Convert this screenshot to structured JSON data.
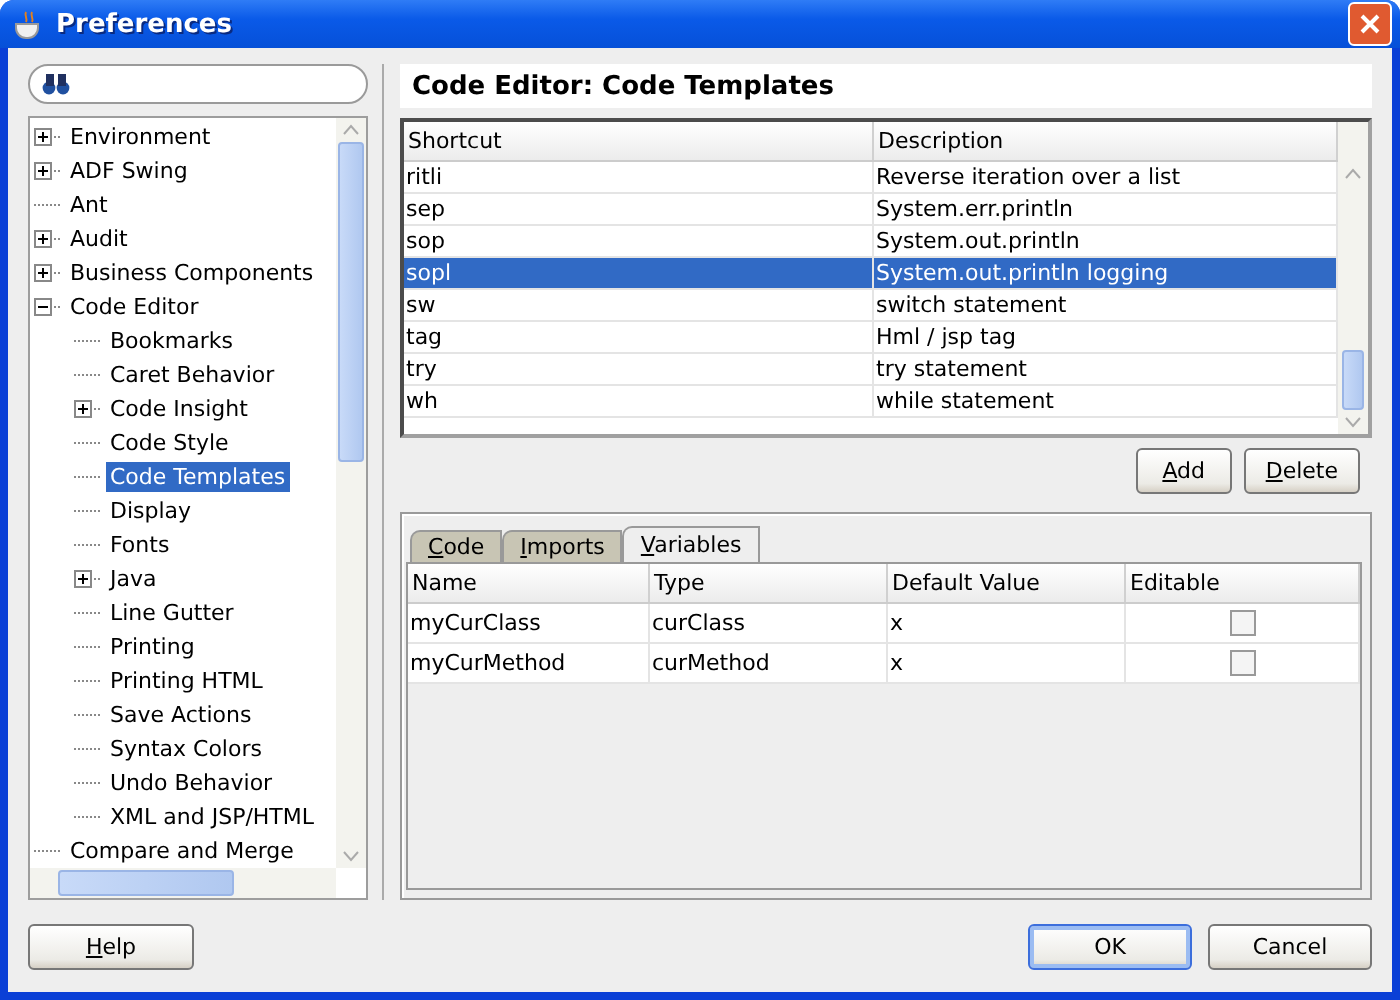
{
  "window": {
    "title": "Preferences"
  },
  "tree": [
    {
      "label": "Environment",
      "expanded": false,
      "selected": false
    },
    {
      "label": "ADF Swing",
      "expanded": false,
      "selected": false
    },
    {
      "label": "Ant",
      "selected": false
    },
    {
      "label": "Audit",
      "expanded": false,
      "selected": false
    },
    {
      "label": "Business Components",
      "expanded": false,
      "selected": false
    },
    {
      "label": "Code Editor",
      "expanded": true,
      "selected": false,
      "children": [
        {
          "label": "Bookmarks",
          "selected": false
        },
        {
          "label": "Caret Behavior",
          "selected": false
        },
        {
          "label": "Code Insight",
          "expanded": false,
          "selected": false
        },
        {
          "label": "Code Style",
          "selected": false
        },
        {
          "label": "Code Templates",
          "selected": true
        },
        {
          "label": "Display",
          "selected": false
        },
        {
          "label": "Fonts",
          "selected": false
        },
        {
          "label": "Java",
          "expanded": false,
          "selected": false
        },
        {
          "label": "Line Gutter",
          "selected": false
        },
        {
          "label": "Printing",
          "selected": false
        },
        {
          "label": "Printing HTML",
          "selected": false
        },
        {
          "label": "Save Actions",
          "selected": false
        },
        {
          "label": "Syntax Colors",
          "selected": false
        },
        {
          "label": "Undo Behavior",
          "selected": false
        },
        {
          "label": "XML and JSP/HTML",
          "selected": false
        }
      ]
    },
    {
      "label": "Compare and Merge",
      "selected": false
    }
  ],
  "heading": "Code Editor: Code Templates",
  "templates": {
    "columns": [
      "Shortcut",
      "Description"
    ],
    "rows": [
      {
        "cells": [
          "ritli",
          "Reverse iteration over a list"
        ],
        "selected": false
      },
      {
        "cells": [
          "sep",
          "System.err.println"
        ],
        "selected": false
      },
      {
        "cells": [
          "sop",
          "System.out.println"
        ],
        "selected": false
      },
      {
        "cells": [
          "sopl",
          "System.out.println logging"
        ],
        "selected": true
      },
      {
        "cells": [
          "sw",
          "switch statement"
        ],
        "selected": false
      },
      {
        "cells": [
          "tag",
          "Hml / jsp tag"
        ],
        "selected": false
      },
      {
        "cells": [
          "try",
          "try statement"
        ],
        "selected": false
      },
      {
        "cells": [
          "wh",
          "while statement"
        ],
        "selected": false
      }
    ]
  },
  "template_buttons": [
    {
      "label": "Add",
      "mnemonic": true
    },
    {
      "label": "Delete",
      "mnemonic": true
    }
  ],
  "tabs": [
    {
      "label": "Code",
      "selected": false,
      "mnemonic": true
    },
    {
      "label": "Imports",
      "selected": false,
      "mnemonic": true
    },
    {
      "label": "Variables",
      "selected": true,
      "mnemonic": true
    }
  ],
  "variables": {
    "columns": [
      "Name",
      "Type",
      "Default Value",
      "Editable"
    ],
    "rows": [
      {
        "cells": [
          "myCurClass",
          "curClass",
          "x"
        ],
        "editable": false
      },
      {
        "cells": [
          "myCurMethod",
          "curMethod",
          "x"
        ],
        "editable": false
      }
    ]
  },
  "footer": {
    "left": [
      {
        "label": "Help",
        "mnemonic": true,
        "default": false
      }
    ],
    "right": [
      {
        "label": "OK",
        "mnemonic": false,
        "default": true
      },
      {
        "label": "Cancel",
        "mnemonic": false,
        "default": false
      }
    ]
  }
}
